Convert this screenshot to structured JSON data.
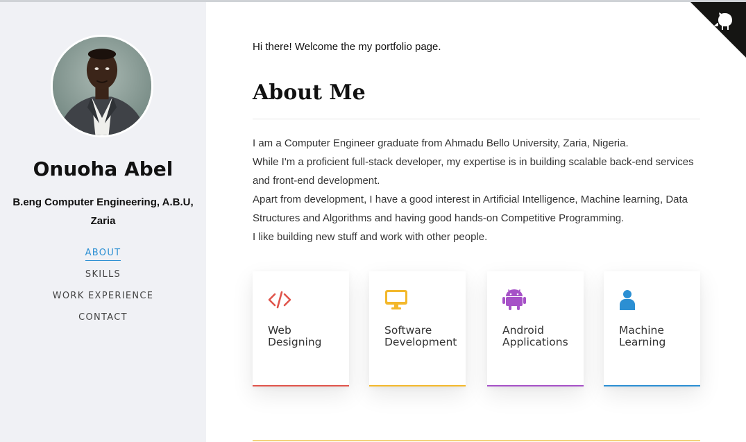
{
  "profile": {
    "name": "Onuoha Abel",
    "degree": "B.eng Computer Engineering, A.B.U, Zaria"
  },
  "nav": {
    "items": [
      {
        "label": "ABOUT",
        "active": true
      },
      {
        "label": "SKILLS",
        "active": false
      },
      {
        "label": "WORK EXPERIENCE",
        "active": false
      },
      {
        "label": "CONTACT",
        "active": false
      }
    ]
  },
  "corner": {
    "icon": "github-octocat-icon"
  },
  "main": {
    "greeting": "Hi there! Welcome the my portfolio page.",
    "section_title": "About Me",
    "about_lines": [
      "I am a Computer Engineer graduate from Ahmadu Bello University, Zaria, Nigeria.",
      "While I'm a proficient full-stack developer, my expertise is in building scalable back-end services and front-end development.",
      "Apart from development, I have a good interest in Artificial Intelligence, Machine learning, Data Structures and Algorithms and having good hands-on Competitive Programming.",
      "I like building new stuff and work with other people."
    ]
  },
  "cards": [
    {
      "label_line1": "Web",
      "label_line2": "Designing",
      "icon": "code-icon",
      "color": "#e0544b"
    },
    {
      "label_line1": "Software",
      "label_line2": "Development",
      "icon": "monitor-icon",
      "color": "#f3b82c"
    },
    {
      "label_line1": "Android",
      "label_line2": "Applications",
      "icon": "android-icon",
      "color": "#a651c7"
    },
    {
      "label_line1": "Machine",
      "label_line2": "Learning",
      "icon": "user-icon",
      "color": "#2b8fd3"
    }
  ],
  "colors": {
    "sidebar_bg": "#f0f1f5",
    "accent": "#2b8fd3"
  }
}
